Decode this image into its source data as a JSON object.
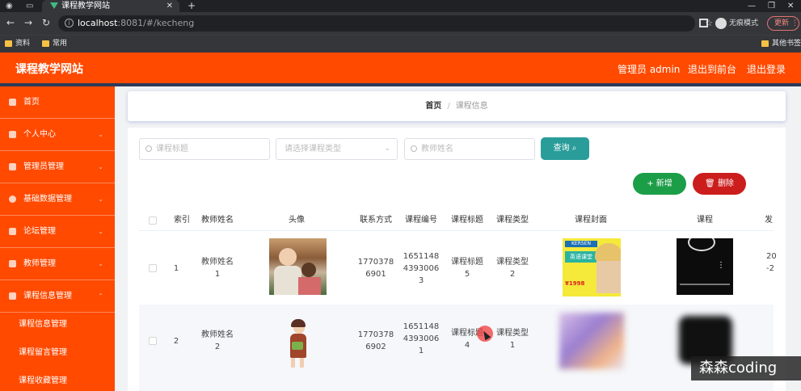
{
  "browser": {
    "tab_title": "课程教学网站",
    "url_host": "localhost",
    "url_rest": ":8081/#/kecheng",
    "profile_label": "无痕模式",
    "update_label": "更新",
    "bookmarks": [
      "资料",
      "常用"
    ],
    "other_bookmarks": "其他书签"
  },
  "header": {
    "title": "课程教学网站",
    "links": [
      "管理员 admin",
      "退出到前台",
      "退出登录"
    ]
  },
  "sidebar": {
    "items": [
      {
        "label": "首页",
        "has_arrow": false
      },
      {
        "label": "个人中心",
        "has_arrow": true
      },
      {
        "label": "管理员管理",
        "has_arrow": true
      },
      {
        "label": "基础数据管理",
        "has_arrow": true
      },
      {
        "label": "论坛管理",
        "has_arrow": true
      },
      {
        "label": "教师管理",
        "has_arrow": true
      },
      {
        "label": "课程信息管理",
        "has_arrow": true
      }
    ],
    "sub_items": [
      "课程信息管理",
      "课程留言管理",
      "课程收藏管理"
    ]
  },
  "breadcrumb": {
    "home": "首页",
    "separator": "/",
    "current": "课程信息"
  },
  "search": {
    "title_placeholder": "课程标题",
    "type_placeholder": "请选择课程类型",
    "teacher_placeholder": "教师姓名",
    "query_label": "查询"
  },
  "actions": {
    "add_label": "新增",
    "delete_label": "删除"
  },
  "table": {
    "headers": [
      "索引",
      "教师姓名",
      "头像",
      "联系方式",
      "课程编号",
      "课程标题",
      "课程类型",
      "课程封面",
      "课程",
      "发"
    ],
    "rows": [
      {
        "index": "1",
        "teacher": [
          "教师姓名",
          "1"
        ],
        "phone": [
          "1770378",
          "6901"
        ],
        "code": [
          "1651148",
          "4393006",
          "3"
        ],
        "title": [
          "课程标题",
          "5"
        ],
        "type": [
          "课程类型",
          "2"
        ],
        "extra": [
          "20",
          "-2"
        ]
      },
      {
        "index": "2",
        "teacher": [
          "教师姓名",
          "2"
        ],
        "phone": [
          "1770378",
          "6902"
        ],
        "code": [
          "1651148",
          "4393006",
          "1"
        ],
        "title": [
          "课程标题",
          "4"
        ],
        "type": [
          "课程类型",
          "1"
        ],
        "extra": [
          "",
          ""
        ]
      }
    ],
    "cover_text": [
      "KERSEN",
      "英语课堂",
      "¥1998"
    ]
  },
  "watermark": "森森coding",
  "colors": {
    "brand": "#ff4a00",
    "query": "#2a9d9a",
    "add": "#1c9e48",
    "delete": "#cc1d1d"
  }
}
